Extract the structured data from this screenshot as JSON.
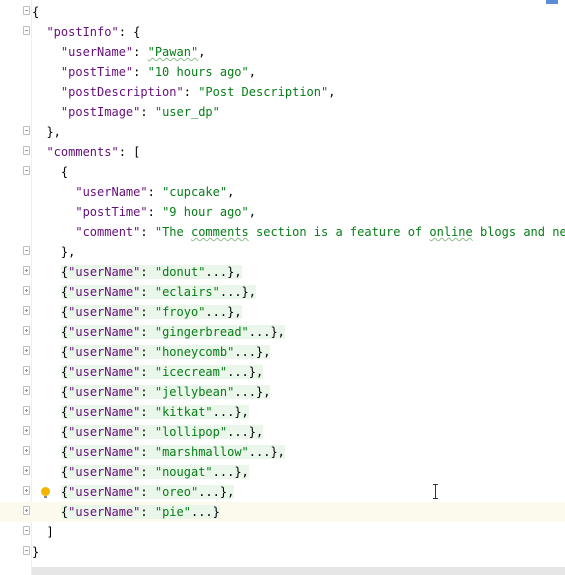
{
  "lines": [
    {
      "indent": "",
      "parts": [
        {
          "t": "{",
          "c": "p"
        }
      ],
      "fold": "minus"
    },
    {
      "indent": "  ",
      "parts": [
        {
          "t": "\"postInfo\"",
          "c": "k"
        },
        {
          "t": ": {",
          "c": "p"
        }
      ],
      "fold": "minus"
    },
    {
      "indent": "    ",
      "parts": [
        {
          "t": "\"userName\"",
          "c": "k"
        },
        {
          "t": ": ",
          "c": "p"
        },
        {
          "t": "\"Pawan\"",
          "c": "s",
          "sq": true
        },
        {
          "t": ",",
          "c": "p"
        }
      ]
    },
    {
      "indent": "    ",
      "parts": [
        {
          "t": "\"postTime\"",
          "c": "k"
        },
        {
          "t": ": ",
          "c": "p"
        },
        {
          "t": "\"10 hours ago\"",
          "c": "s"
        },
        {
          "t": ",",
          "c": "p"
        }
      ]
    },
    {
      "indent": "    ",
      "parts": [
        {
          "t": "\"postDescription\"",
          "c": "k"
        },
        {
          "t": ": ",
          "c": "p"
        },
        {
          "t": "\"Post Description\"",
          "c": "s"
        },
        {
          "t": ",",
          "c": "p"
        }
      ]
    },
    {
      "indent": "    ",
      "parts": [
        {
          "t": "\"postImage\"",
          "c": "k"
        },
        {
          "t": ": ",
          "c": "p"
        },
        {
          "t": "\"user_dp\"",
          "c": "s"
        }
      ]
    },
    {
      "indent": "  ",
      "parts": [
        {
          "t": "},",
          "c": "p"
        }
      ],
      "fold": "minus"
    },
    {
      "indent": "  ",
      "parts": [
        {
          "t": "\"comments\"",
          "c": "k"
        },
        {
          "t": ": [",
          "c": "p"
        }
      ],
      "fold": "minus"
    },
    {
      "indent": "    ",
      "parts": [
        {
          "t": "{",
          "c": "p"
        }
      ],
      "fold": "minus"
    },
    {
      "indent": "      ",
      "parts": [
        {
          "t": "\"userName\"",
          "c": "k"
        },
        {
          "t": ": ",
          "c": "p"
        },
        {
          "t": "\"cupcake\"",
          "c": "s"
        },
        {
          "t": ",",
          "c": "p"
        }
      ]
    },
    {
      "indent": "      ",
      "parts": [
        {
          "t": "\"postTime\"",
          "c": "k"
        },
        {
          "t": ": ",
          "c": "p"
        },
        {
          "t": "\"9 hour ago\"",
          "c": "s"
        },
        {
          "t": ",",
          "c": "p"
        }
      ]
    },
    {
      "indent": "      ",
      "parts": [
        {
          "t": "\"comment\"",
          "c": "k"
        },
        {
          "t": ": ",
          "c": "p"
        },
        {
          "t": "\"The ",
          "c": "s"
        },
        {
          "t": "comments",
          "c": "s",
          "sq": true
        },
        {
          "t": " section is a feature of ",
          "c": "s"
        },
        {
          "t": "online",
          "c": "s",
          "sq": true
        },
        {
          "t": " blogs and news",
          "c": "s"
        }
      ]
    },
    {
      "indent": "    ",
      "parts": [
        {
          "t": "},",
          "c": "p"
        }
      ],
      "fold": "minus"
    },
    {
      "indent": "    ",
      "folded": true,
      "parts": [
        {
          "t": "{",
          "c": "p"
        },
        {
          "t": "\"userName\"",
          "c": "k"
        },
        {
          "t": ": ",
          "c": "p"
        },
        {
          "t": "\"donut\"",
          "c": "s"
        },
        {
          "t": "...},",
          "c": "p"
        }
      ],
      "fold": "plus"
    },
    {
      "indent": "    ",
      "folded": true,
      "parts": [
        {
          "t": "{",
          "c": "p"
        },
        {
          "t": "\"userName\"",
          "c": "k"
        },
        {
          "t": ": ",
          "c": "p"
        },
        {
          "t": "\"eclairs\"",
          "c": "s"
        },
        {
          "t": "...},",
          "c": "p"
        }
      ],
      "fold": "plus"
    },
    {
      "indent": "    ",
      "folded": true,
      "parts": [
        {
          "t": "{",
          "c": "p"
        },
        {
          "t": "\"userName\"",
          "c": "k"
        },
        {
          "t": ": ",
          "c": "p"
        },
        {
          "t": "\"froyo\"",
          "c": "s"
        },
        {
          "t": "...},",
          "c": "p"
        }
      ],
      "fold": "plus"
    },
    {
      "indent": "    ",
      "folded": true,
      "parts": [
        {
          "t": "{",
          "c": "p"
        },
        {
          "t": "\"userName\"",
          "c": "k"
        },
        {
          "t": ": ",
          "c": "p"
        },
        {
          "t": "\"gingerbread\"",
          "c": "s"
        },
        {
          "t": "...},",
          "c": "p"
        }
      ],
      "fold": "plus"
    },
    {
      "indent": "    ",
      "folded": true,
      "parts": [
        {
          "t": "{",
          "c": "p"
        },
        {
          "t": "\"userName\"",
          "c": "k"
        },
        {
          "t": ": ",
          "c": "p"
        },
        {
          "t": "\"honeycomb\"",
          "c": "s"
        },
        {
          "t": "...},",
          "c": "p"
        }
      ],
      "fold": "plus"
    },
    {
      "indent": "    ",
      "folded": true,
      "parts": [
        {
          "t": "{",
          "c": "p"
        },
        {
          "t": "\"userName\"",
          "c": "k"
        },
        {
          "t": ": ",
          "c": "p"
        },
        {
          "t": "\"icecream\"",
          "c": "s"
        },
        {
          "t": "...},",
          "c": "p"
        }
      ],
      "fold": "plus"
    },
    {
      "indent": "    ",
      "folded": true,
      "parts": [
        {
          "t": "{",
          "c": "p"
        },
        {
          "t": "\"userName\"",
          "c": "k"
        },
        {
          "t": ": ",
          "c": "p"
        },
        {
          "t": "\"jellybean\"",
          "c": "s"
        },
        {
          "t": "...},",
          "c": "p"
        }
      ],
      "fold": "plus"
    },
    {
      "indent": "    ",
      "folded": true,
      "parts": [
        {
          "t": "{",
          "c": "p"
        },
        {
          "t": "\"userName\"",
          "c": "k"
        },
        {
          "t": ": ",
          "c": "p"
        },
        {
          "t": "\"kitkat\"",
          "c": "s"
        },
        {
          "t": "...},",
          "c": "p"
        }
      ],
      "fold": "plus"
    },
    {
      "indent": "    ",
      "folded": true,
      "parts": [
        {
          "t": "{",
          "c": "p"
        },
        {
          "t": "\"userName\"",
          "c": "k"
        },
        {
          "t": ": ",
          "c": "p"
        },
        {
          "t": "\"lollipop\"",
          "c": "s"
        },
        {
          "t": "...},",
          "c": "p"
        }
      ],
      "fold": "plus"
    },
    {
      "indent": "    ",
      "folded": true,
      "parts": [
        {
          "t": "{",
          "c": "p"
        },
        {
          "t": "\"userName\"",
          "c": "k"
        },
        {
          "t": ": ",
          "c": "p"
        },
        {
          "t": "\"marshmallow\"",
          "c": "s"
        },
        {
          "t": "...},",
          "c": "p"
        }
      ],
      "fold": "plus"
    },
    {
      "indent": "    ",
      "folded": true,
      "parts": [
        {
          "t": "{",
          "c": "p"
        },
        {
          "t": "\"userName\"",
          "c": "k"
        },
        {
          "t": ": ",
          "c": "p"
        },
        {
          "t": "\"nougat\"",
          "c": "s"
        },
        {
          "t": "...},",
          "c": "p"
        }
      ],
      "fold": "plus"
    },
    {
      "indent": "    ",
      "folded": true,
      "bulb": true,
      "parts": [
        {
          "t": "{",
          "c": "p"
        },
        {
          "t": "\"userName\"",
          "c": "k"
        },
        {
          "t": ": ",
          "c": "p"
        },
        {
          "t": "\"oreo\"",
          "c": "s"
        },
        {
          "t": "...},",
          "c": "p"
        }
      ],
      "fold": "plus"
    },
    {
      "indent": "    ",
      "folded": true,
      "current": true,
      "parts": [
        {
          "t": "{",
          "c": "p"
        },
        {
          "t": "\"userName\"",
          "c": "k"
        },
        {
          "t": ": ",
          "c": "p"
        },
        {
          "t": "\"pie\"",
          "c": "s"
        },
        {
          "t": "...}",
          "c": "p"
        }
      ],
      "fold": "plus"
    },
    {
      "indent": "  ",
      "parts": [
        {
          "t": "]",
          "c": "p"
        }
      ],
      "fold": "minus"
    },
    {
      "indent": "",
      "parts": [
        {
          "t": "}",
          "c": "p"
        }
      ],
      "fold": "minus"
    }
  ],
  "icons": {
    "bulb": "lightbulb-icon",
    "cursor": "text-cursor-icon"
  },
  "colors": {
    "key": "#660e7a",
    "string": "#067d17",
    "fold_highlight": "#eaf6ea",
    "current_line": "#fcfaed"
  }
}
